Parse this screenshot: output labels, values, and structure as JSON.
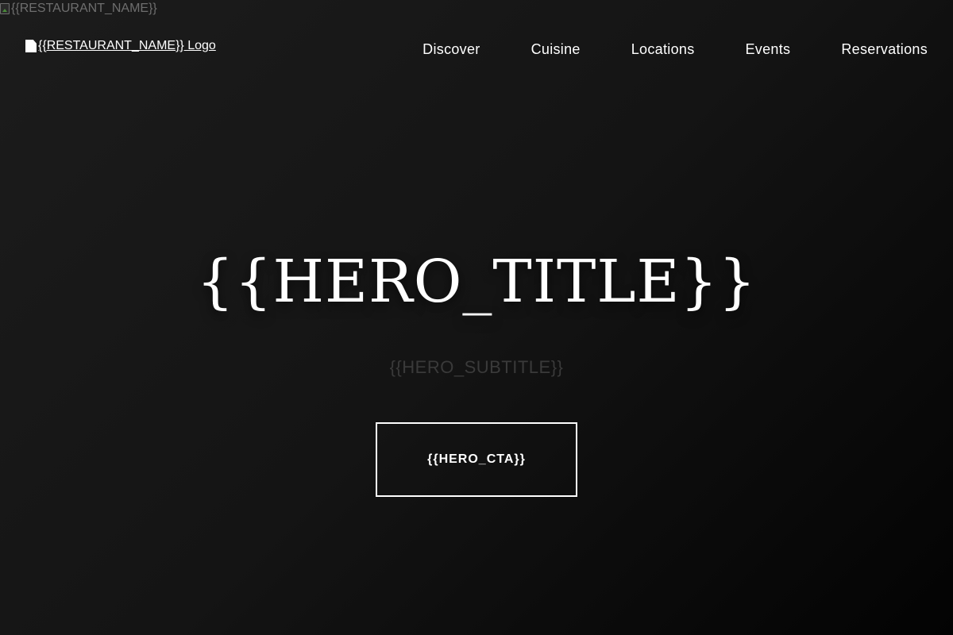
{
  "broken_image": {
    "alt": "{{RESTAURANT_NAME}}"
  },
  "header": {
    "logo_alt": "{{RESTAURANT_NAME}} Logo",
    "nav": [
      {
        "label": "Discover"
      },
      {
        "label": "Cuisine"
      },
      {
        "label": "Locations"
      },
      {
        "label": "Events"
      },
      {
        "label": "Reservations"
      }
    ]
  },
  "hero": {
    "title": "{{HERO_TITLE}}",
    "subtitle": "{{HERO_SUBTITLE}}",
    "cta": "{{HERO_CTA}}"
  },
  "colors": {
    "background": "#161616",
    "text": "#ffffff",
    "subtitle": "#3a3a3a",
    "broken_image_text": "#6e6e6e"
  },
  "icons": {
    "broken_image": "broken-image-icon",
    "logo_broken": "broken-image-icon"
  }
}
